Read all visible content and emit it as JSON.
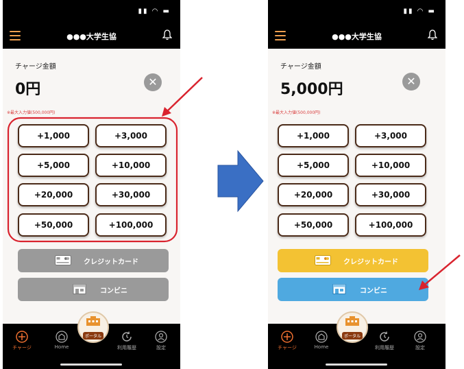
{
  "phones": [
    {
      "app": {
        "title": "●●●大学生協"
      },
      "charge": {
        "label": "チャージ金額",
        "amount": "0円",
        "max_note": "※最大入力値(500,000円)"
      },
      "amount_buttons": [
        "+1,000",
        "+3,000",
        "+5,000",
        "+10,000",
        "+20,000",
        "+30,000",
        "+50,000",
        "+100,000"
      ],
      "payment": {
        "credit_label": "クレジットカード",
        "konbini_label": "コンビニ",
        "credit_color": "#9a9a9a",
        "konbini_color": "#9a9a9a"
      },
      "tabs": {
        "charge": "チャージ",
        "home": "Home",
        "portal": "ポータル",
        "history": "利用履歴",
        "settings": "設定"
      }
    },
    {
      "app": {
        "title": "●●●大学生協"
      },
      "charge": {
        "label": "チャージ金額",
        "amount": "5,000円",
        "max_note": "※最大入力値(500,000円)"
      },
      "amount_buttons": [
        "+1,000",
        "+3,000",
        "+5,000",
        "+10,000",
        "+20,000",
        "+30,000",
        "+50,000",
        "+100,000"
      ],
      "payment": {
        "credit_label": "クレジットカード",
        "konbini_label": "コンビニ",
        "credit_color": "#f3c233",
        "konbini_color": "#4fa9e0"
      },
      "tabs": {
        "charge": "チャージ",
        "home": "Home",
        "portal": "ポータル",
        "history": "利用履歴",
        "settings": "設定"
      }
    }
  ],
  "colors": {
    "highlight": "#d9232e",
    "arrow": "#3a6fc4",
    "accent": "#f07030"
  }
}
